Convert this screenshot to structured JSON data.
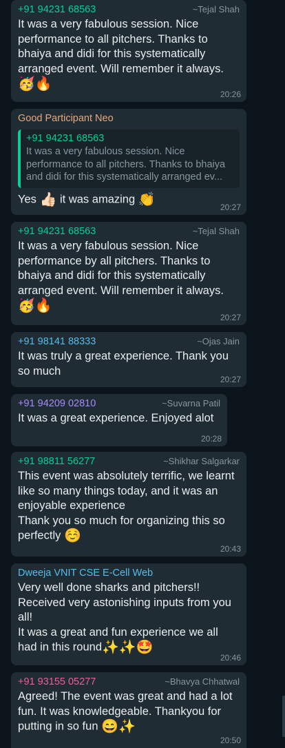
{
  "messages": [
    {
      "sender": "+91 94231 68563",
      "alias": "~Tejal Shah",
      "color": "#06cf9c",
      "text": "It was a very fabulous session. Nice performance to all pitchers. Thanks to bhaiya and didi for this systematically arranged event. Will remember it always.",
      "emoji": "🥳🔥",
      "time": "20:26"
    },
    {
      "sender": "Good Participant Neo",
      "color": "#e8a87c",
      "quote": {
        "sender": "+91 94231 68563",
        "text": "It was a very fabulous session. Nice performance to all pitchers. Thanks to bhaiya and didi for this systematically arranged ev..."
      },
      "text_parts": [
        "Yes ",
        "👍🏻",
        " it was amazing ",
        "👏"
      ],
      "time": "20:27"
    },
    {
      "sender": "+91 94231 68563",
      "alias": "~Tejal Shah",
      "color": "#06cf9c",
      "text": "It was a very fabulous session. Nice performance by all pitchers. Thanks to bhaiya and didi for this systematically arranged event. Will remember it always.",
      "emoji": "🥳🔥",
      "time": "20:27"
    },
    {
      "sender": "+91 98141 88333",
      "alias": "~Ojas Jain",
      "color": "#53bdeb",
      "text": "It was truly a great experience. Thank you so much",
      "time": "20:27"
    },
    {
      "sender": "+91 94209 02810",
      "alias": "~Suvarna Patil",
      "color": "#a78bfa",
      "text": "It was a great experience. Enjoyed alot",
      "time": "20:28"
    },
    {
      "sender": "+91 98811 56277",
      "alias": "~Shikhar Salgarkar",
      "color": "#06cf9c",
      "text": "This event was absolutely terrific, we learnt like so many things today, and it was an enjoyable experience\nThank you so much for organizing this so perfectly ",
      "emoji": "☺️",
      "time": "20:43"
    },
    {
      "sender": "Dweeja VNIT CSE E-Cell Web",
      "color": "#53bdeb",
      "text": "Very well done sharks and pitchers!!\nReceived very astonishing inputs from you all!\nIt was a great and fun experience we all had in this round",
      "emoji": "✨✨🤩",
      "time": "20:46"
    },
    {
      "sender": "+91 93155 05277",
      "alias": "~Bhavya Chhatwal",
      "color": "#f15c9e",
      "text": "Agreed! The event was great and had a lot fun. It was knowledgeable. Thankyou for putting in so fun ",
      "emoji": "😄✨",
      "time": "20:50"
    }
  ]
}
